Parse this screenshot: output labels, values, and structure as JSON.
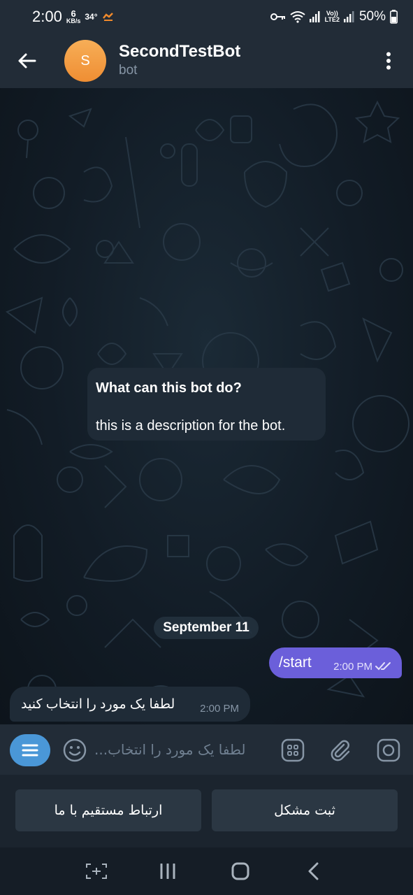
{
  "status_bar": {
    "time": "2:00",
    "speed_value": "6",
    "speed_unit": "KB/s",
    "temperature": "34°",
    "volte_line1": "Vo))",
    "volte_line2": "LTE2",
    "battery": "50%"
  },
  "header": {
    "avatar_letter": "S",
    "title": "SecondTestBot",
    "subtitle": "bot",
    "back_icon": "arrow-left-icon",
    "menu_icon": "more-vertical-icon"
  },
  "chat": {
    "intro_title": "What can this bot do?",
    "intro_description": "this is a description for the bot.",
    "date_separator": "September 11",
    "messages": [
      {
        "direction": "out",
        "text": "/start",
        "time": "2:00 PM",
        "read": true
      },
      {
        "direction": "in",
        "text": "لطفا یک مورد را انتخاب کنید",
        "time": "2:00 PM"
      }
    ]
  },
  "input": {
    "placeholder": "لطفا یک مورد را انتخاب..."
  },
  "reply_keyboard": [
    {
      "label": "ارتباط مستقیم با ما"
    },
    {
      "label": "ثبت مشکل"
    }
  ],
  "colors": {
    "header_bg": "#222c37",
    "accent_blue": "#4a97d7",
    "outgoing_bubble": "#6b5fda",
    "incoming_bubble": "#1f2b37",
    "avatar_orange": "#ef8e33"
  }
}
